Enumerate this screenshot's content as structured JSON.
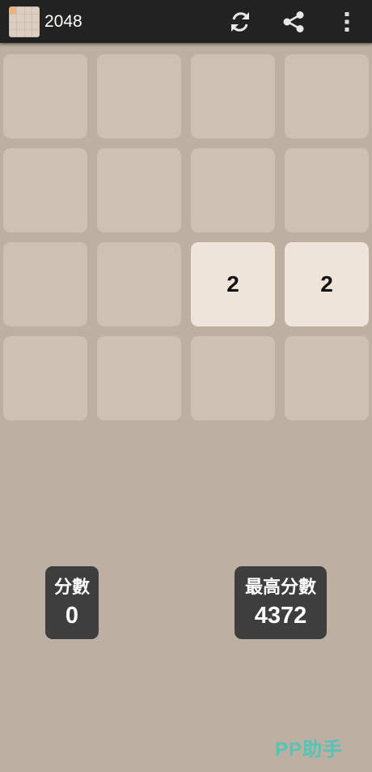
{
  "app": {
    "title": "2048",
    "icon_name": "app-2048-icon"
  },
  "toolbar": {
    "icons": [
      "refresh-icon",
      "share-icon",
      "overflow-menu-icon"
    ]
  },
  "board": {
    "size": 4,
    "rows": [
      [
        null,
        null,
        null,
        null
      ],
      [
        null,
        null,
        null,
        null
      ],
      [
        null,
        null,
        2,
        2
      ],
      [
        null,
        null,
        null,
        null
      ]
    ]
  },
  "score": {
    "label": "分數",
    "value": "0"
  },
  "best": {
    "label": "最高分數",
    "value": "4372"
  },
  "watermark": "PP助手",
  "colors": {
    "background": "#bdb0a3",
    "empty_cell": "#cdc1b4",
    "tile_2": "#eee4da",
    "score_box": "#3e3e3e",
    "action_bar": "#222222",
    "watermark": "#58c3b5"
  }
}
